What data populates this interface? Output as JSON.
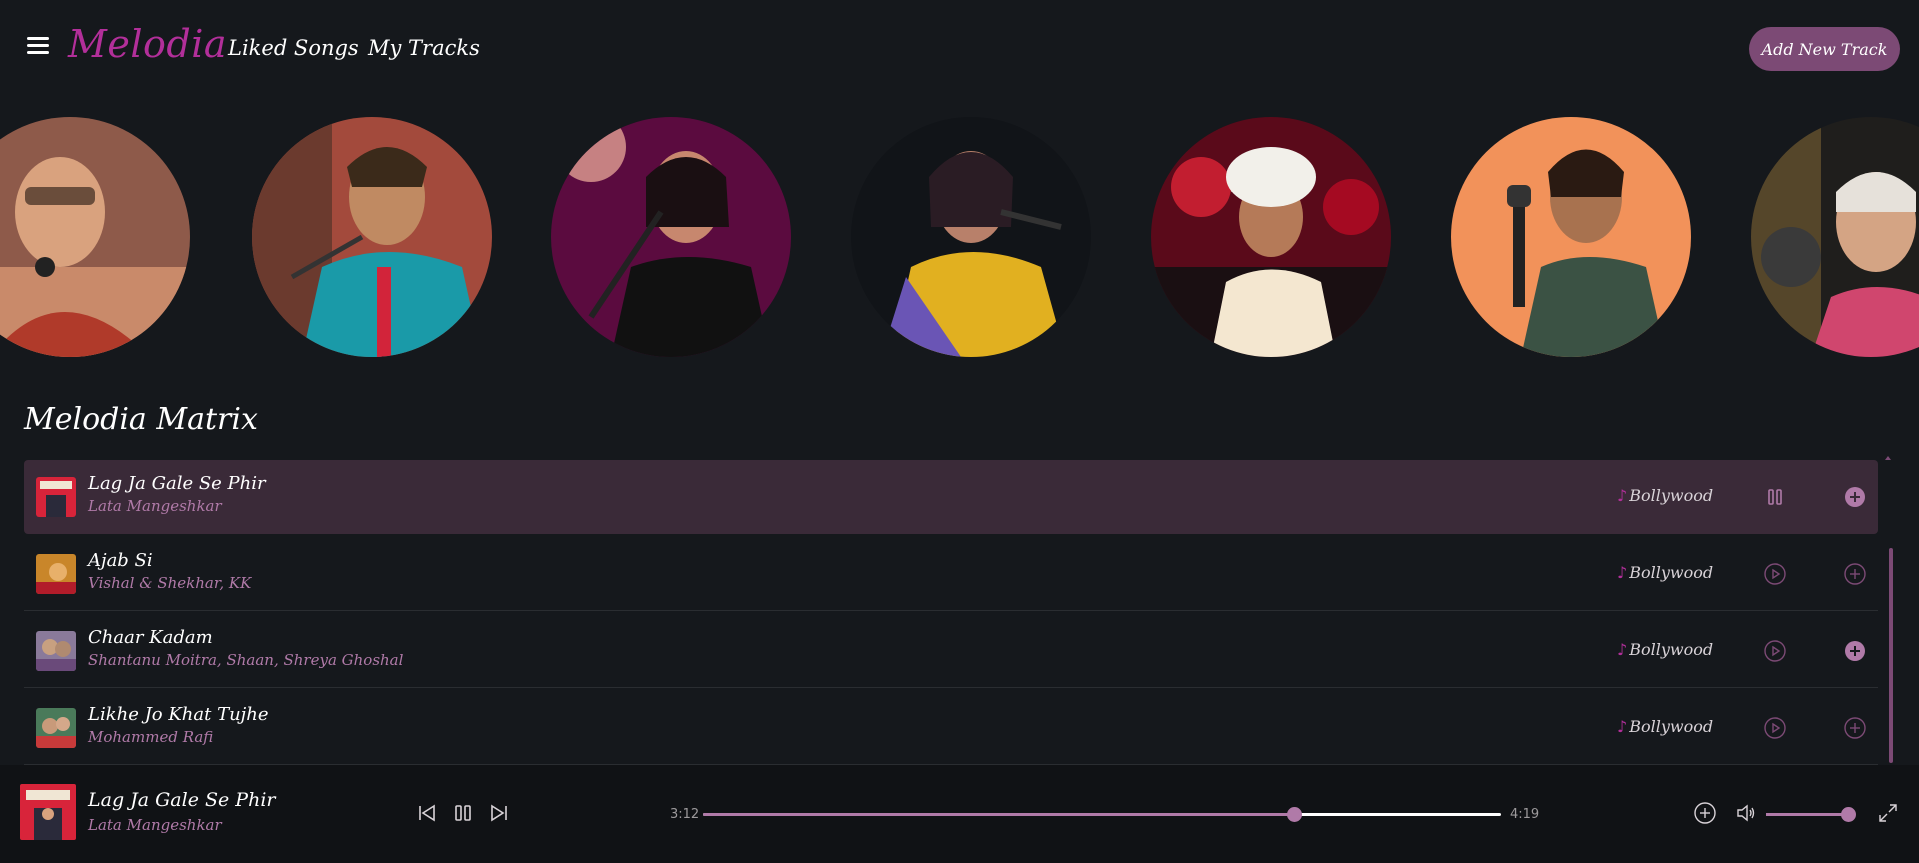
{
  "header": {
    "logo": "Melodia",
    "nav": [
      "Liked Songs",
      "My Tracks"
    ],
    "add_button": "Add New Track"
  },
  "artists": [
    {
      "icon": "artist-photo-1"
    },
    {
      "icon": "artist-photo-2"
    },
    {
      "icon": "artist-photo-3"
    },
    {
      "icon": "artist-photo-4"
    },
    {
      "icon": "artist-photo-5"
    },
    {
      "icon": "artist-photo-6"
    },
    {
      "icon": "artist-photo-7"
    }
  ],
  "section_title": "Melodia Matrix",
  "tracks": [
    {
      "title": "Lag Ja Gale Se Phir",
      "artist": "Lata Mangeshkar",
      "genre": "Bollywood",
      "state": "playing",
      "added": true
    },
    {
      "title": "Ajab Si",
      "artist": "Vishal & Shekhar, KK",
      "genre": "Bollywood",
      "state": "paused",
      "added": false
    },
    {
      "title": "Chaar Kadam",
      "artist": "Shantanu Moitra, Shaan, Shreya Ghoshal",
      "genre": "Bollywood",
      "state": "paused",
      "added": true
    },
    {
      "title": "Likhe Jo Khat Tujhe",
      "artist": "Mohammed Rafi",
      "genre": "Bollywood",
      "state": "paused",
      "added": false
    }
  ],
  "player": {
    "title": "Lag Ja Gale Se Phir",
    "artist": "Lata Mangeshkar",
    "current_time": "3:12",
    "total_time": "4:19",
    "progress": 0.74,
    "volume": 0.95
  },
  "colors": {
    "accent": "#b22f9a",
    "muted_accent": "#7c4a75",
    "artist_text": "#b07aa8",
    "background": "#15181c"
  }
}
